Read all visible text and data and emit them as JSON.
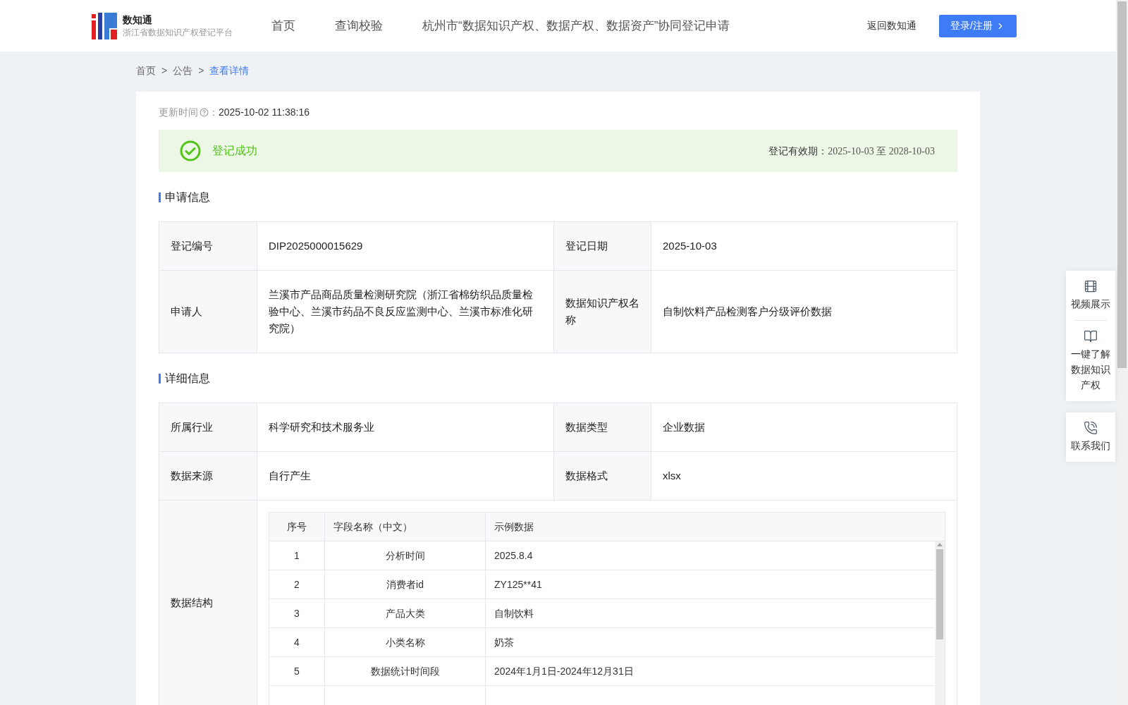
{
  "header": {
    "logo": {
      "title": "数知通",
      "subtitle": "浙江省数据知识产权登记平台"
    },
    "nav": [
      "首页",
      "查询校验",
      "杭州市“数据知识产权、数据产权、数据资产”协同登记申请"
    ],
    "back_link": "返回数知通",
    "login_button": "登录/注册"
  },
  "breadcrumb": [
    {
      "label": "首页",
      "current": false
    },
    {
      "label": "公告",
      "current": false
    },
    {
      "label": "查看详情",
      "current": true
    }
  ],
  "breadcrumb_separator": ">",
  "update": {
    "label": "更新时间",
    "colon": "：",
    "value": "2025-10-02 11:38:16"
  },
  "status": {
    "text": "登记成功",
    "validity_label": "登记有效期：",
    "validity_value": "2025-10-03 至 2028-10-03"
  },
  "sections": [
    {
      "title": "申请信息",
      "rows": [
        {
          "kind": "pair",
          "cells": [
            {
              "label": "登记编号",
              "value": "DIP2025000015629"
            },
            {
              "label": "登记日期",
              "value": "2025-10-03"
            }
          ]
        },
        {
          "kind": "pair",
          "cells": [
            {
              "label": "申请人",
              "value": "兰溪市产品商品质量检测研究院（浙江省棉纺织品质量检验中心、兰溪市药品不良反应监测中心、兰溪市标准化研究院）"
            },
            {
              "label": "数据知识产权名称",
              "value": "自制饮料产品检测客户分级评价数据"
            }
          ]
        }
      ]
    },
    {
      "title": "详细信息",
      "rows": [
        {
          "kind": "pair",
          "cells": [
            {
              "label": "所属行业",
              "value": "科学研究和技术服务业"
            },
            {
              "label": "数据类型",
              "value": "企业数据"
            }
          ]
        },
        {
          "kind": "pair",
          "cells": [
            {
              "label": "数据来源",
              "value": "自行产生"
            },
            {
              "label": "数据格式",
              "value": "xlsx"
            }
          ]
        },
        {
          "kind": "table",
          "label": "数据结构",
          "columns": [
            "序号",
            "字段名称（中文）",
            "示例数据"
          ],
          "rows": [
            [
              "1",
              "分析时间",
              "2025.8.4"
            ],
            [
              "2",
              "消费者id",
              "ZY125**41"
            ],
            [
              "3",
              "产品大类",
              "自制饮料"
            ],
            [
              "4",
              "小类名称",
              "奶茶"
            ],
            [
              "5",
              "数据统计时间段",
              "2024年1月1日-2024年12月31日"
            ]
          ]
        }
      ]
    }
  ],
  "side_panel": [
    {
      "items": [
        {
          "kind": "video",
          "label": "视频展示"
        },
        {
          "kind": "book",
          "label": "一键了解数据知识产权"
        }
      ]
    },
    {
      "items": [
        {
          "kind": "phone",
          "label": "联系我们"
        }
      ]
    }
  ]
}
